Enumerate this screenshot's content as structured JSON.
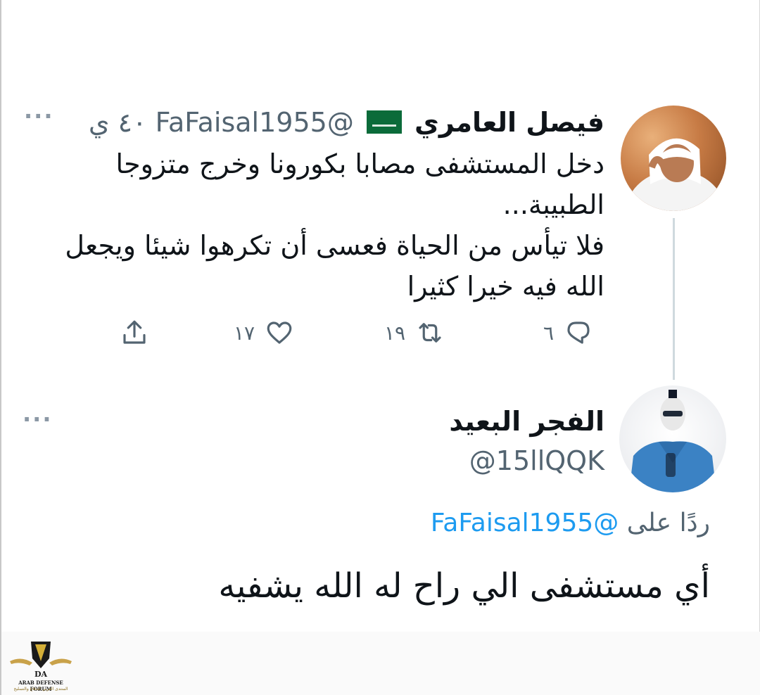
{
  "original_tweet": {
    "display_name": "فيصل العامري",
    "handle": "@FaFaisal1955",
    "timestamp": "٤٠ ي",
    "body_lines": [
      "دخل المستشفى مصابا بكورونا وخرج متزوجا الطبيبة...",
      "فلا تيأس من الحياة فعسى أن تكرهوا شيئا ويجعل الله فيه خيرا كثيرا"
    ],
    "menu": "···",
    "replies_count": "٦",
    "retweets_count": "١٩",
    "likes_count": "١٧"
  },
  "reply_tweet": {
    "display_name": "الفجر البعيد",
    "handle": "@15llQQK",
    "replying_to_prefix": "ردًا على",
    "replying_to_mention": "@FaFaisal1955",
    "text": "أي مستشفى الي راح له الله يشفيه",
    "menu": "···"
  },
  "icons": {
    "reply": "reply-icon",
    "retweet": "retweet-icon",
    "like": "heart-icon",
    "share": "share-icon",
    "flag": "saudi-flag-icon"
  },
  "colors": {
    "text": "#0f1419",
    "secondary": "#536471",
    "link": "#1d9bf0",
    "thread_line": "#cfd9de"
  }
}
